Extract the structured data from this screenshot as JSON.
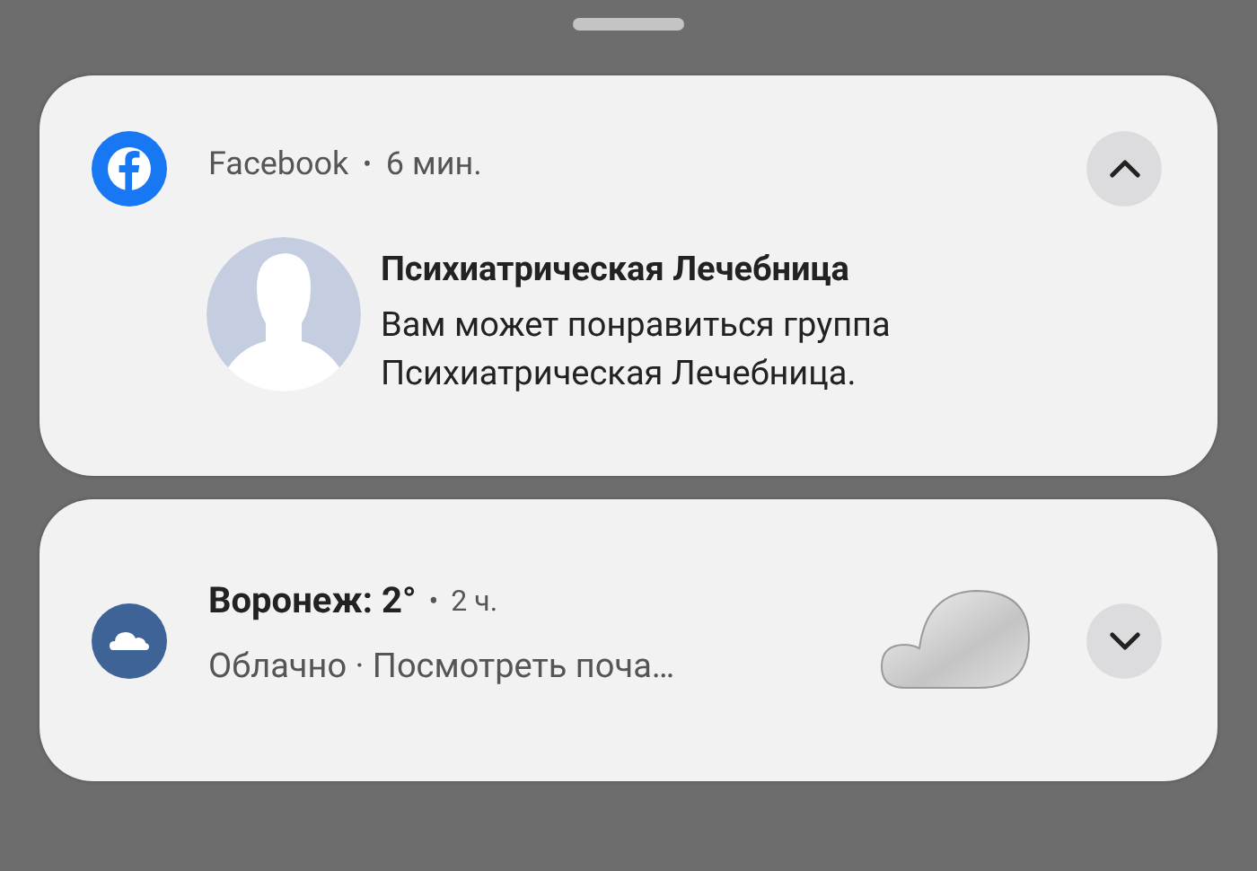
{
  "notifications": [
    {
      "kind": "social",
      "expanded": true,
      "app": "Facebook",
      "separator": "•",
      "time": "6 мин.",
      "title": "Психиатрическая Лечебница",
      "body": "Вам может понравиться группа Психиатрическая Лечебница."
    },
    {
      "kind": "weather",
      "expanded": false,
      "title": "Воронеж: 2°",
      "separator": "•",
      "time": "2 ч.",
      "body": "Облачно · Посмотреть поча…"
    }
  ]
}
